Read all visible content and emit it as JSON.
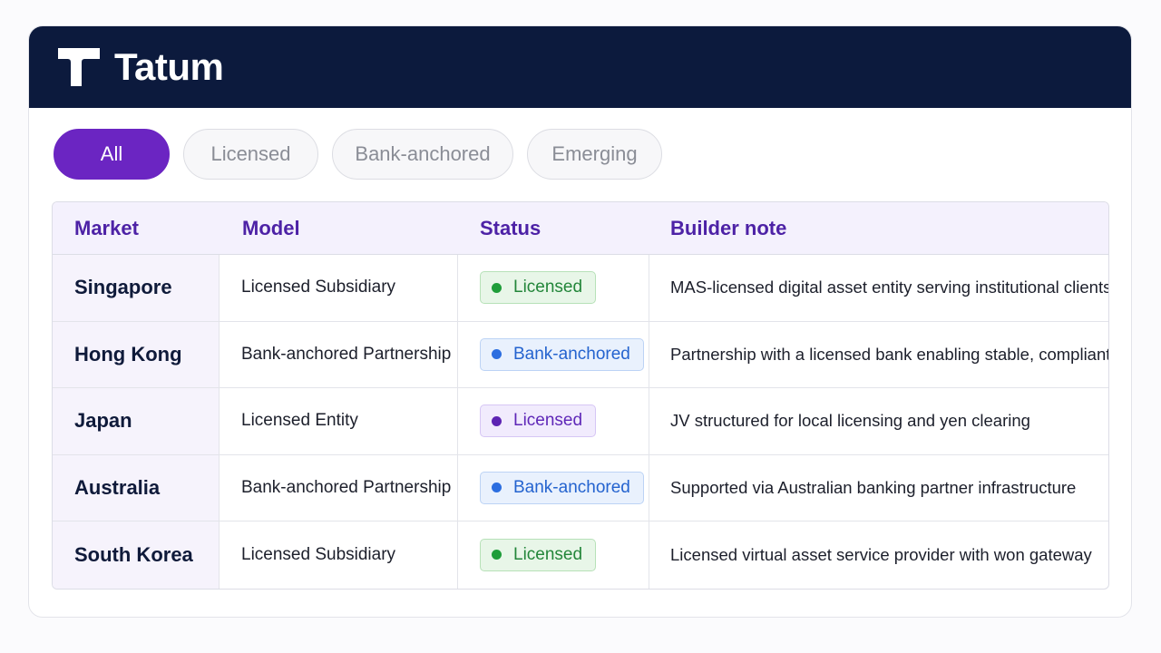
{
  "app": {
    "name": "Tatum"
  },
  "filters": [
    {
      "label": "All",
      "active": true
    },
    {
      "label": "Licensed",
      "active": false
    },
    {
      "label": "Bank-anchored",
      "active": false
    },
    {
      "label": "Emerging",
      "active": false
    }
  ],
  "table": {
    "columns": [
      "Market",
      "Model",
      "Status",
      "Builder note"
    ],
    "rows": [
      {
        "market": "Singapore",
        "model": "Licensed Subsidiary",
        "status": "Licensed",
        "status_color": "#1f9d3a",
        "note": "MAS-licensed digital asset entity serving institutional clients"
      },
      {
        "market": "Hong Kong",
        "model": "Bank-anchored Partnership",
        "status": "Bank-anchored",
        "status_color": "#2c6ee0",
        "note": "Partnership with a licensed bank enabling stable, compliant access"
      },
      {
        "market": "Japan",
        "model": "Licensed Entity",
        "status": "Licensed",
        "status_color": "#5d24b3",
        "note": "JV structured for local licensing and yen clearing"
      },
      {
        "market": "Australia",
        "model": "Bank-anchored Partnership",
        "status": "Bank-anchored",
        "status_color": "#2c6ee0",
        "note": "Supported via Australian banking partner infrastructure"
      },
      {
        "market": "South Korea",
        "model": "Licensed Subsidiary",
        "status": "Licensed",
        "status_color": "#1f9d3a",
        "note": "Licensed virtual asset service provider with won gateway"
      }
    ]
  },
  "colors": {
    "header_bg": "#0c1a3d",
    "accent": "#6b25c2",
    "heading_text": "#4d22a6"
  }
}
